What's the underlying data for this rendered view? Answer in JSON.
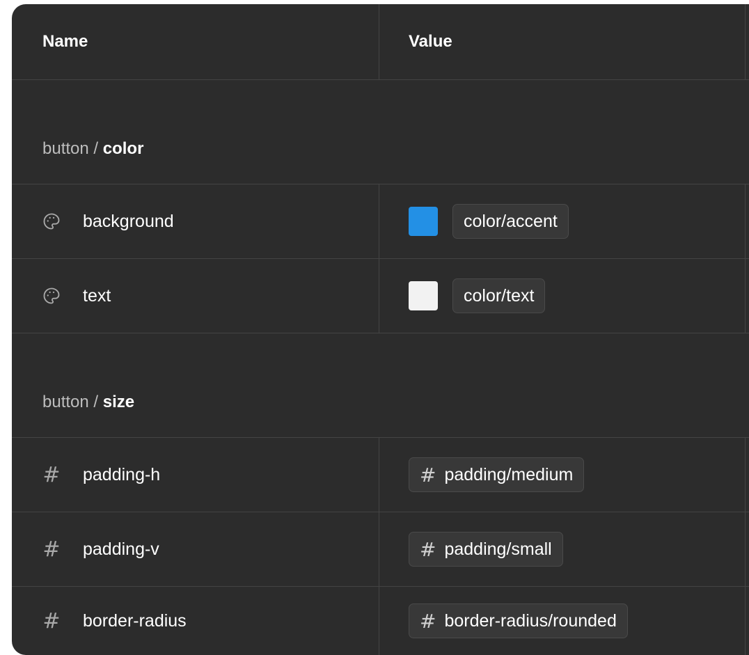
{
  "table": {
    "header": {
      "name": "Name",
      "value": "Value"
    },
    "groups": [
      {
        "prefix": "button / ",
        "name": "color",
        "rows": [
          {
            "icon": "palette-icon",
            "name": "background",
            "swatch_color": "#2390e5",
            "value": "color/accent"
          },
          {
            "icon": "palette-icon",
            "name": "text",
            "swatch_color": "#f2f2f2",
            "value": "color/text"
          }
        ]
      },
      {
        "prefix": "button / ",
        "name": "size",
        "rows": [
          {
            "icon": "hash-icon",
            "name": "padding-h",
            "value_icon": "hash-icon",
            "value": "padding/medium"
          },
          {
            "icon": "hash-icon",
            "name": "padding-v",
            "value_icon": "hash-icon",
            "value": "padding/small"
          },
          {
            "icon": "hash-icon",
            "name": "border-radius",
            "value_icon": "hash-icon",
            "value": "border-radius/rounded"
          }
        ]
      }
    ]
  },
  "colors": {
    "background": "#2c2c2c",
    "border": "#444444",
    "chip_background": "#383838"
  }
}
